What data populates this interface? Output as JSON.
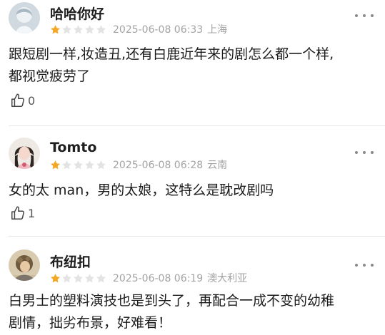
{
  "comments": [
    {
      "username": "哈哈你好",
      "rating": 1,
      "max_rating": 5,
      "date": "2025-06-08 06:33",
      "location": "上海",
      "text_lines": [
        "跟短剧一样,妆造丑,还有白鹿近年来的剧怎么都一个样,",
        "都视觉疲劳了"
      ],
      "likes": "0"
    },
    {
      "username": "Tomto",
      "rating": 1,
      "max_rating": 5,
      "date": "2025-06-08 06:28",
      "location": "云南",
      "text_lines": [
        "女的太 man，男的太娘，这特么是耽改剧吗"
      ],
      "likes": "1"
    },
    {
      "username": "布纽扣",
      "rating": 1,
      "max_rating": 5,
      "date": "2025-06-08 06:19",
      "location": "澳大利亚",
      "text_lines": [
        "白男士的塑料演技也是到头了，再配合一成不变的幼稚",
        "剧情，拙劣布景，好难看！"
      ]
    }
  ],
  "colors": {
    "star_filled": "#F5A623",
    "star_empty": "#E3E3E3",
    "meta_text": "#A3A3A3",
    "divider": "#E8E8E8"
  },
  "icons": [
    "star-icon",
    "more-options-icon",
    "thumbs-up-icon"
  ]
}
